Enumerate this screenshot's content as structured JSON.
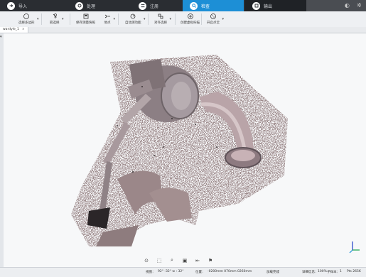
{
  "tabs": [
    {
      "label": "导入",
      "icon": "import-icon",
      "active": false
    },
    {
      "label": "处理",
      "icon": "process-icon",
      "active": false
    },
    {
      "label": "注册",
      "icon": "register-icon",
      "active": false
    },
    {
      "label": "检查",
      "icon": "inspect-icon",
      "active": true
    },
    {
      "label": "输出",
      "icon": "export-icon",
      "active": false
    }
  ],
  "ribbon": {
    "tools": [
      {
        "label": "选择多边形",
        "icon": "lasso-select-icon",
        "dropdown": true
      },
      {
        "label": "箭选择",
        "icon": "arrow-select-icon",
        "dropdown": true
      },
      {
        "label": "保存测量快照",
        "icon": "save-snapshot-icon",
        "dropdown": false
      },
      {
        "label": "地点",
        "icon": "location-icon",
        "dropdown": true
      },
      {
        "label": "自动测功能",
        "icon": "auto-measure-icon",
        "dropdown": true
      },
      {
        "label": "对齐选择",
        "icon": "align-select-icon",
        "dropdown": true
      },
      {
        "label": "创建虚拟扫描",
        "icon": "virtual-scan-icon",
        "dropdown": false
      },
      {
        "label": "开启点云",
        "icon": "point-cloud-icon",
        "dropdown": true
      }
    ]
  },
  "document_tab": {
    "label": "wardyle_1",
    "close": "×"
  },
  "status": {
    "view_label": "视图：",
    "view_value": "92° -32° w : 32°",
    "position_label": "位置：",
    "position_value": "-0200mm 070mm 0260mm",
    "load_label": "加载完成",
    "progress_label": "详细信息：",
    "progress_value": "100%",
    "subsample_label": "子样本：",
    "subsample_value": "1",
    "points_value": "Pts 265K"
  },
  "bottom_tools": [
    {
      "name": "navigate-icon",
      "glyph": "⊙"
    },
    {
      "name": "view-cube-icon",
      "glyph": "⬚"
    },
    {
      "name": "zoom-icon",
      "glyph": "⌕"
    },
    {
      "name": "box-view-icon",
      "glyph": "▣"
    },
    {
      "name": "clip-plane-icon",
      "glyph": "⇤"
    },
    {
      "name": "flag-icon",
      "glyph": "⚑"
    }
  ],
  "colors": {
    "tab_bar": "#2a2d32",
    "accent": "#1d8fd6",
    "ribbon": "#eef0f3"
  }
}
